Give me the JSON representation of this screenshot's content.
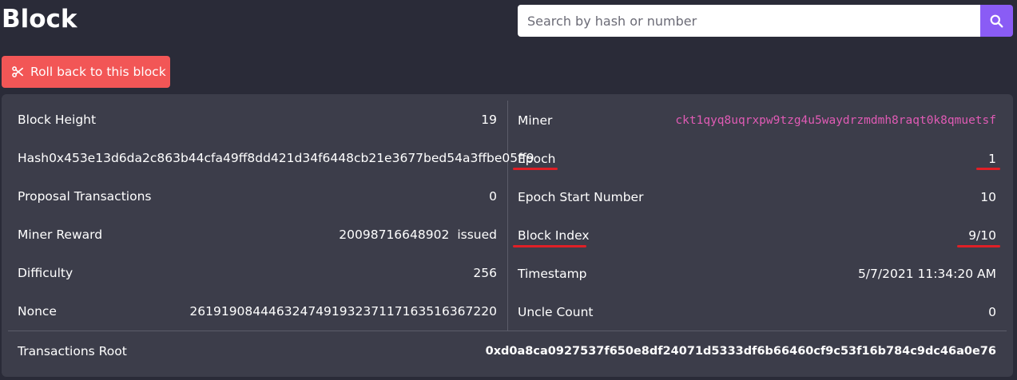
{
  "header": {
    "title": "Block"
  },
  "search": {
    "placeholder": "Search by hash or number",
    "value": "",
    "button_icon": "search-icon"
  },
  "actions": {
    "rollback_label": "Roll back to this block",
    "rollback_icon": "scissors-icon"
  },
  "left": {
    "block_height_label": "Block Height",
    "block_height_value": "19",
    "hash_label": "Hash",
    "hash_value": "0x453e13d6da2c863b44cfa49ff8dd421d34f6448cb21e3677bed54a3ffbe05ff9",
    "proposal_label": "Proposal Transactions",
    "proposal_value": "0",
    "reward_label": "Miner Reward",
    "reward_value": "20098716648902",
    "reward_status": "issued",
    "difficulty_label": "Difficulty",
    "difficulty_value": "256",
    "nonce_label": "Nonce",
    "nonce_value": "261919084446324749193237117163516367220"
  },
  "right": {
    "miner_label": "Miner",
    "miner_value": "ckt1qyq8uqrxpw9tzg4u5waydrzmdmh8raqt0k8qmuetsf",
    "epoch_label": "Epoch",
    "epoch_value": "1",
    "epoch_start_label": "Epoch Start Number",
    "epoch_start_value": "10",
    "block_index_label": "Block Index",
    "block_index_value": "9/10",
    "timestamp_label": "Timestamp",
    "timestamp_value": "5/7/2021 11:34:20 AM",
    "uncle_label": "Uncle Count",
    "uncle_value": "0"
  },
  "footer": {
    "tx_root_label": "Transactions Root",
    "tx_root_value": "0xd0a8ca0927537f650e8df24071d5333df6b66460cf9c53f16b784c9dc46a0e76"
  },
  "colors": {
    "background": "#2a2b38",
    "card": "#3c3d4a",
    "accent": "#8a5cf5",
    "danger": "#f25656",
    "miner_link": "#e05bb5",
    "annotation": "#e01f26"
  }
}
